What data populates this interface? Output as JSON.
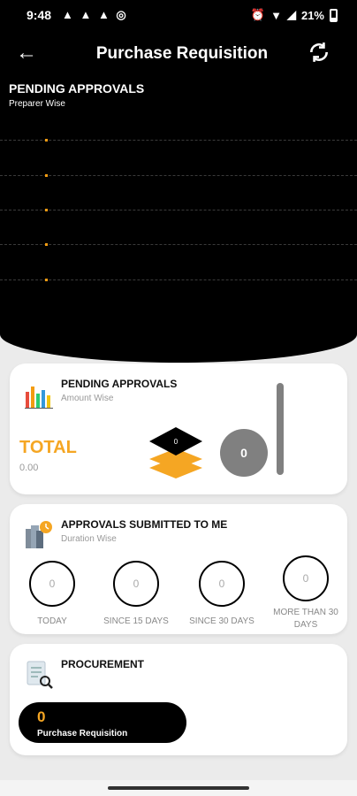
{
  "status": {
    "time": "9:48",
    "notifications": "▲ ▲ ▲ ◎",
    "battery": "21%"
  },
  "appbar": {
    "back_icon": "←",
    "title": "Purchase Requisition"
  },
  "header": {
    "title": "PENDING APPROVALS",
    "subtitle": "Preparer Wise"
  },
  "pending_amount": {
    "title": "PENDING APPROVALS",
    "subtitle": "Amount Wise",
    "total_label": "TOTAL",
    "total_value": "0.00",
    "stack_value": "0",
    "circle_value": "0"
  },
  "submitted": {
    "title": "APPROVALS SUBMITTED TO ME",
    "subtitle": "Duration Wise",
    "items": [
      {
        "value": "0",
        "label": "TODAY"
      },
      {
        "value": "0",
        "label": "SINCE 15 DAYS"
      },
      {
        "value": "0",
        "label": "SINCE 30 DAYS"
      },
      {
        "value": "0",
        "label": "MORE THAN 30 DAYS"
      }
    ]
  },
  "procurement": {
    "title": "PROCUREMENT",
    "count": "0",
    "label": "Purchase Requisition"
  },
  "colors": {
    "accent": "#f5a623",
    "dark": "#000000",
    "gray": "#808080"
  }
}
